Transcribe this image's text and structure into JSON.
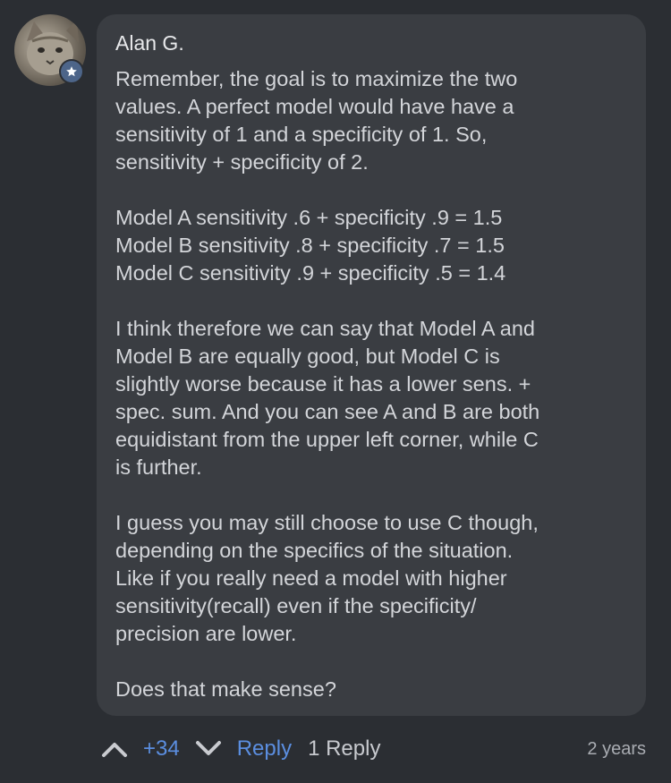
{
  "comment": {
    "author": "Alan G.",
    "avatar_icon": "cat-avatar",
    "badge_icon": "star-icon",
    "paragraphs": [
      "Remember, the goal is to maximize the two\nvalues. A perfect model would have have a\nsensitivity of 1 and a specificity of 1.  So,\nsensitivity + specificity of 2.",
      "Model A sensitivity .6 + specificity .9 = 1.5\nModel B sensitivity .8 + specificity .7 = 1.5\nModel C sensitivity .9 + specificity .5 = 1.4",
      "I think therefore we can say that Model A and\nModel B are equally good, but Model C is\nslightly worse because it has a lower sens. +\nspec. sum.  And you can see A and B are both\nequidistant from the upper left corner, while C\nis further.",
      "I guess you may still choose to use C though,\ndepending on the specifics of the situation.\nLike if you really need a model with higher\nsensitivity(recall) even if the specificity/\nprecision are lower.",
      "Does that make sense?"
    ]
  },
  "actions": {
    "score": "+34",
    "reply_label": "Reply",
    "reply_count": "1 Reply",
    "timestamp": "2 years"
  },
  "colors": {
    "background": "#2b2e33",
    "bubble": "#3a3d42",
    "accent": "#5b8ee0",
    "badge": "#4d6589"
  }
}
